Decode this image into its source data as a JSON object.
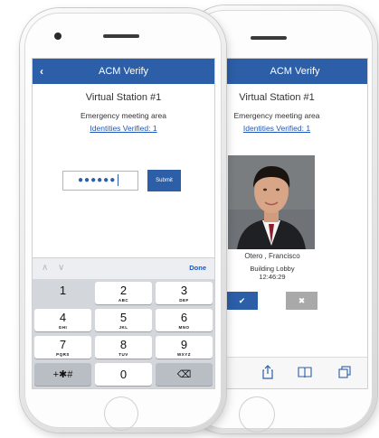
{
  "front": {
    "header_title": "ACM Verify",
    "back_glyph": "‹",
    "station_title": "Virtual Station #1",
    "area_label": "Emergency meeting area",
    "identities_link": "Identities Verified: 1",
    "pin_mask": "●●●●●●",
    "submit_label": "Submit",
    "keyboard": {
      "up_arrow": "∧",
      "down_arrow": "∨",
      "done_label": "Done",
      "keys": [
        {
          "num": "1",
          "letters": ""
        },
        {
          "num": "2",
          "letters": "ABC"
        },
        {
          "num": "3",
          "letters": "DEF"
        },
        {
          "num": "4",
          "letters": "GHI"
        },
        {
          "num": "5",
          "letters": "JKL"
        },
        {
          "num": "6",
          "letters": "MNO"
        },
        {
          "num": "7",
          "letters": "PQRS"
        },
        {
          "num": "8",
          "letters": "TUV"
        },
        {
          "num": "9",
          "letters": "WXYZ"
        },
        {
          "num": "+✱#",
          "letters": ""
        },
        {
          "num": "0",
          "letters": ""
        },
        {
          "num": "⌫",
          "letters": ""
        }
      ]
    }
  },
  "back": {
    "header_title": "ACM Verify",
    "station_title": "Virtual Station #1",
    "area_label": "Emergency meeting area",
    "identities_link": "Identities Verified: 1",
    "person_name": "Otero , Francisco",
    "location": "Building Lobby",
    "time": "12:46:29",
    "approve_glyph": "✔",
    "reject_glyph": "✖",
    "toolbar_icons": [
      "share-icon",
      "bookmarks-icon",
      "tabs-icon"
    ]
  },
  "colors": {
    "accent": "#2c5fa8",
    "link": "#1f56b8",
    "reject_gray": "#a9a9a9"
  }
}
